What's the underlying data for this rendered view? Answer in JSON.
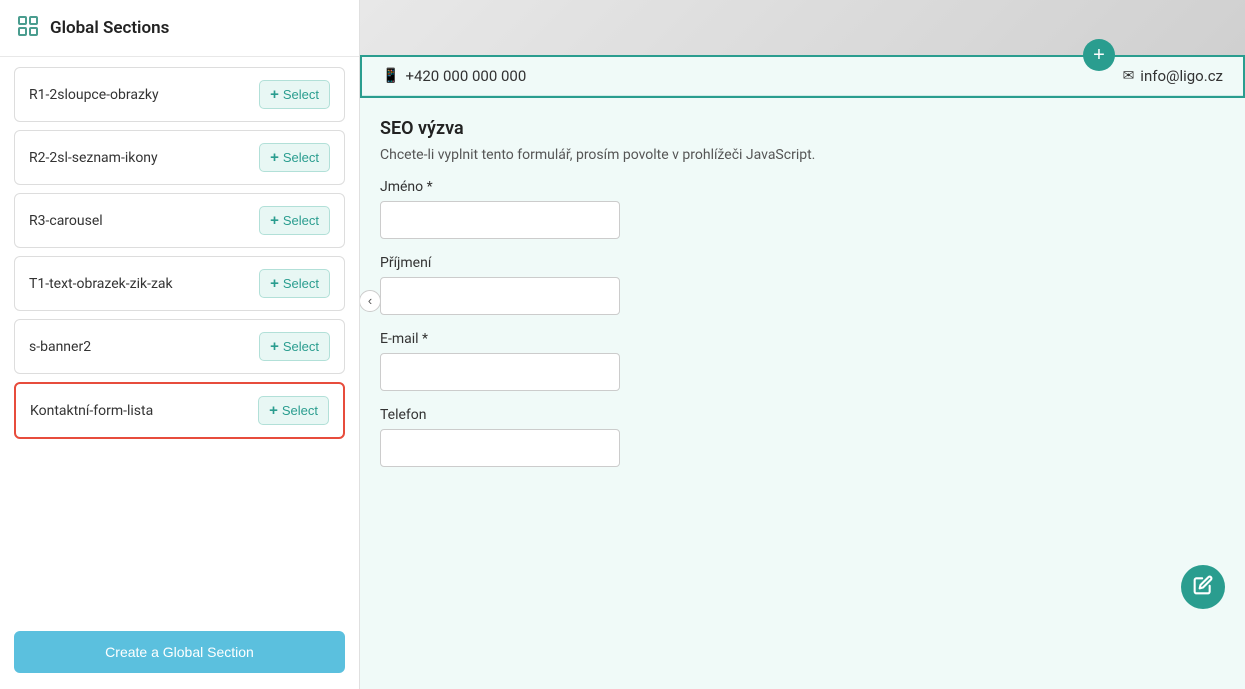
{
  "sidebar": {
    "title": "Global Sections",
    "items": [
      {
        "id": "item-1",
        "name": "R1-2sloupce-obrazky",
        "selected": false
      },
      {
        "id": "item-2",
        "name": "R2-2sl-seznam-ikony",
        "selected": false
      },
      {
        "id": "item-3",
        "name": "R3-carousel",
        "selected": false
      },
      {
        "id": "item-4",
        "name": "T1-text-obrazek-zik-zak",
        "selected": false
      },
      {
        "id": "item-5",
        "name": "s-banner2",
        "selected": false
      },
      {
        "id": "item-6",
        "name": "Kontaktní-form-lista",
        "selected": true
      }
    ],
    "select_btn_label": "Select",
    "create_btn_label": "Create a Global Section"
  },
  "main": {
    "phone": "+420 000 000 000",
    "email": "info@ligo.cz",
    "form_section_title": "SEO výzva",
    "form_note": "Chcete-li vyplnit tento formulář, prosím povolte v prohlížeči JavaScript.",
    "fields": [
      {
        "label": "Jméno *",
        "type": "text"
      },
      {
        "label": "Příjmení",
        "type": "text"
      },
      {
        "label": "E-mail *",
        "type": "text"
      },
      {
        "label": "Telefon",
        "type": "text"
      }
    ],
    "add_icon": "+",
    "edit_icon": "✎",
    "collapse_icon": "‹"
  },
  "icons": {
    "grid_icon": "⊞",
    "phone_icon": "📱",
    "email_icon": "✉"
  }
}
